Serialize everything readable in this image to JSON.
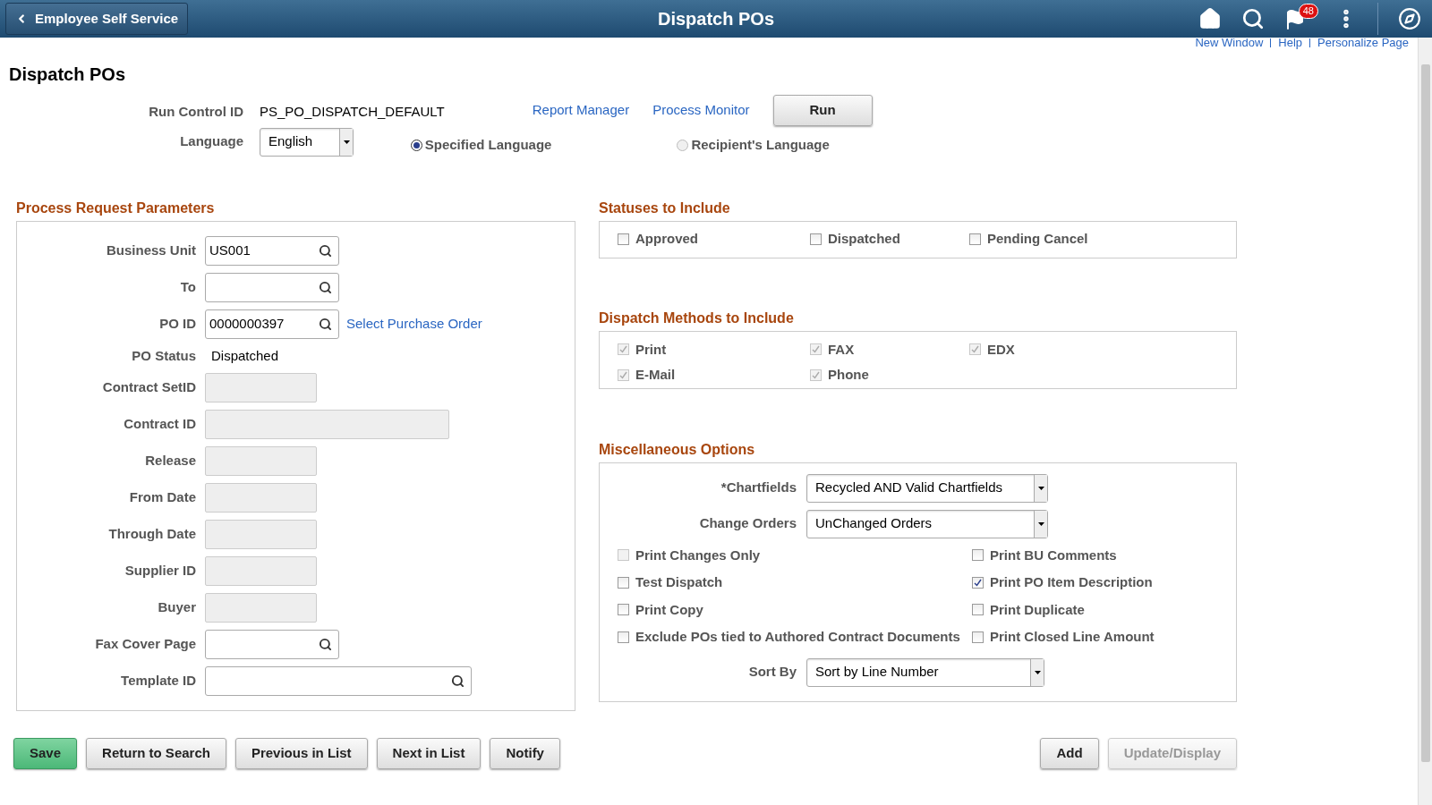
{
  "header": {
    "back_label": "Employee Self Service",
    "title": "Dispatch POs",
    "notification_count": "48"
  },
  "top_links": [
    "New Window",
    "Help",
    "Personalize Page"
  ],
  "page_title": "Dispatch POs",
  "run_control": {
    "label": "Run Control ID",
    "value": "PS_PO_DISPATCH_DEFAULT",
    "links": [
      "Report Manager",
      "Process Monitor"
    ],
    "run_button": "Run"
  },
  "language": {
    "label": "Language",
    "value": "English",
    "options": [
      {
        "label": "Specified Language",
        "selected": true
      },
      {
        "label": "Recipient's Language",
        "selected": false
      }
    ]
  },
  "process_request": {
    "title": "Process Request Parameters",
    "fields": [
      {
        "label": "Business Unit",
        "kind": "lookup",
        "value": "US001"
      },
      {
        "label": "To",
        "kind": "lookup"
      },
      {
        "label": "PO ID",
        "kind": "lookup",
        "value": "0000000397",
        "link": "Select Purchase Order"
      },
      {
        "label": "PO Status",
        "kind": "text",
        "value": "Dispatched"
      },
      {
        "label": "Contract SetID",
        "kind": "disabled"
      },
      {
        "label": "Contract ID",
        "kind": "disabled_wide"
      },
      {
        "label": "Release",
        "kind": "disabled"
      },
      {
        "label": "From Date",
        "kind": "disabled"
      },
      {
        "label": "Through Date",
        "kind": "disabled"
      },
      {
        "label": "Supplier ID",
        "kind": "disabled"
      },
      {
        "label": "Buyer",
        "kind": "disabled"
      },
      {
        "label": "Fax Cover Page",
        "kind": "lookup"
      },
      {
        "label": "Template ID",
        "kind": "lookup_wide"
      }
    ]
  },
  "statuses": {
    "title": "Statuses to Include",
    "items": [
      {
        "label": "Approved",
        "checked": false,
        "disabled": false
      },
      {
        "label": "Dispatched",
        "checked": false,
        "disabled": false
      },
      {
        "label": "Pending Cancel",
        "checked": false,
        "disabled": false
      }
    ]
  },
  "dispatch_methods": {
    "title": "Dispatch Methods to Include",
    "items": [
      {
        "label": "Print",
        "checked": true,
        "disabled": true
      },
      {
        "label": "FAX",
        "checked": true,
        "disabled": true
      },
      {
        "label": "EDX",
        "checked": true,
        "disabled": true
      },
      {
        "label": "E-Mail",
        "checked": true,
        "disabled": true
      },
      {
        "label": "Phone",
        "checked": true,
        "disabled": true
      }
    ]
  },
  "misc": {
    "title": "Miscellaneous Options",
    "selects": [
      {
        "label": "*Chartfields",
        "value": "Recycled AND Valid Chartfields"
      },
      {
        "label": "Change Orders",
        "value": "UnChanged Orders"
      }
    ],
    "options": [
      {
        "label": "Print Changes Only",
        "checked": false,
        "disabled": true
      },
      {
        "label": "Print BU Comments",
        "checked": false,
        "disabled": false
      },
      {
        "label": "Test Dispatch",
        "checked": false,
        "disabled": false
      },
      {
        "label": "Print PO Item Description",
        "checked": true,
        "disabled": false
      },
      {
        "label": "Print Copy",
        "checked": false,
        "disabled": false
      },
      {
        "label": "Print Duplicate",
        "checked": false,
        "disabled": false
      },
      {
        "label": "Exclude POs tied to Authored Contract Documents",
        "checked": false,
        "disabled": false
      },
      {
        "label": "Print Closed Line Amount",
        "checked": false,
        "disabled": false
      }
    ],
    "sort": {
      "label": "Sort By",
      "value": "Sort by Line Number"
    }
  },
  "footer_left": [
    {
      "label": "Save",
      "kind": "primary",
      "disabled": false
    },
    {
      "label": "Return to Search",
      "kind": "normal",
      "disabled": false
    },
    {
      "label": "Previous in List",
      "kind": "normal",
      "disabled": false
    },
    {
      "label": "Next in List",
      "kind": "normal",
      "disabled": false
    },
    {
      "label": "Notify",
      "kind": "normal",
      "disabled": false
    }
  ],
  "footer_right": [
    {
      "label": "Add",
      "kind": "normal",
      "disabled": false
    },
    {
      "label": "Update/Display",
      "kind": "normal",
      "disabled": true
    }
  ]
}
